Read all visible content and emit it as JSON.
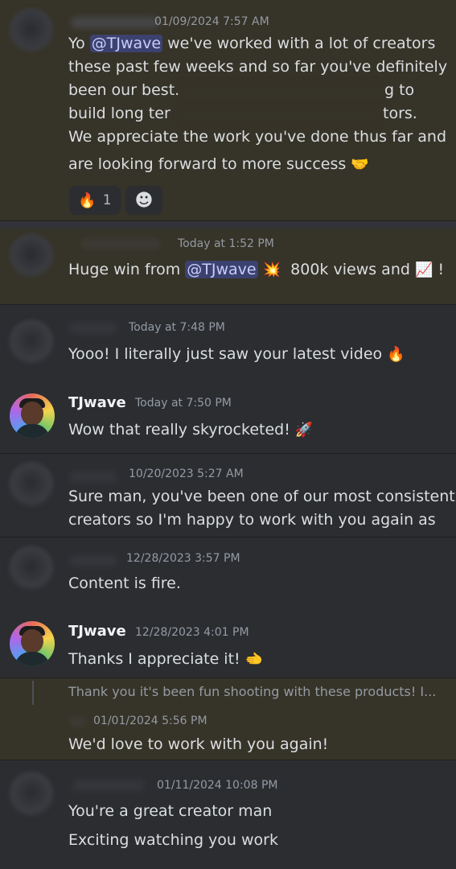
{
  "messages": [
    {
      "timestamp": "01/09/2024 7:57 AM",
      "text_lines": [
        "we've worked with a lot of creators",
        "these past few weeks and so far you've definitely",
        "been our best.",
        "build long ter",
        "We appreciate the work you've done thus far and",
        "are looking forward to more success"
      ],
      "prefix": "Yo",
      "mention": "@TJwave",
      "line3_tail": "g to",
      "line4_tail": "tors.",
      "reaction_count": "1"
    },
    {
      "timestamp": "Today at 1:52 PM",
      "prefix": "Huge win from",
      "mention": "@TJwave",
      "middle": "800k views and",
      "suffix": "!"
    },
    {
      "timestamp": "Today at 7:48 PM",
      "text": "Yooo! I literally just saw your latest video"
    },
    {
      "username": "TJwave",
      "timestamp": "Today at 7:50 PM",
      "text": "Wow that really skyrocketed!"
    },
    {
      "timestamp": "10/20/2023 5:27 AM",
      "text_lines": [
        "Sure man, you've been one of our most consistent",
        "creators so I'm happy to work with you again as"
      ]
    },
    {
      "timestamp": "12/28/2023 3:57 PM",
      "text": "Content is fire."
    },
    {
      "username": "TJwave",
      "timestamp": "12/28/2023 4:01 PM",
      "text": "Thanks I appreciate it!"
    },
    {
      "reply_preview": "Thank you it's been fun shooting with these products! I...",
      "timestamp": "01/01/2024 5:56 PM",
      "text": "We'd love to work with you again!"
    },
    {
      "timestamp": "01/11/2024 10:08 PM",
      "text_lines": [
        "You're a great creator man",
        "Exciting watching you work"
      ]
    }
  ],
  "icons": {
    "fire": "🔥",
    "handshake": "🤝",
    "collision": "💥",
    "chart": "📈",
    "rocket": "🚀",
    "point": "🫲",
    "smiley": "☻"
  }
}
